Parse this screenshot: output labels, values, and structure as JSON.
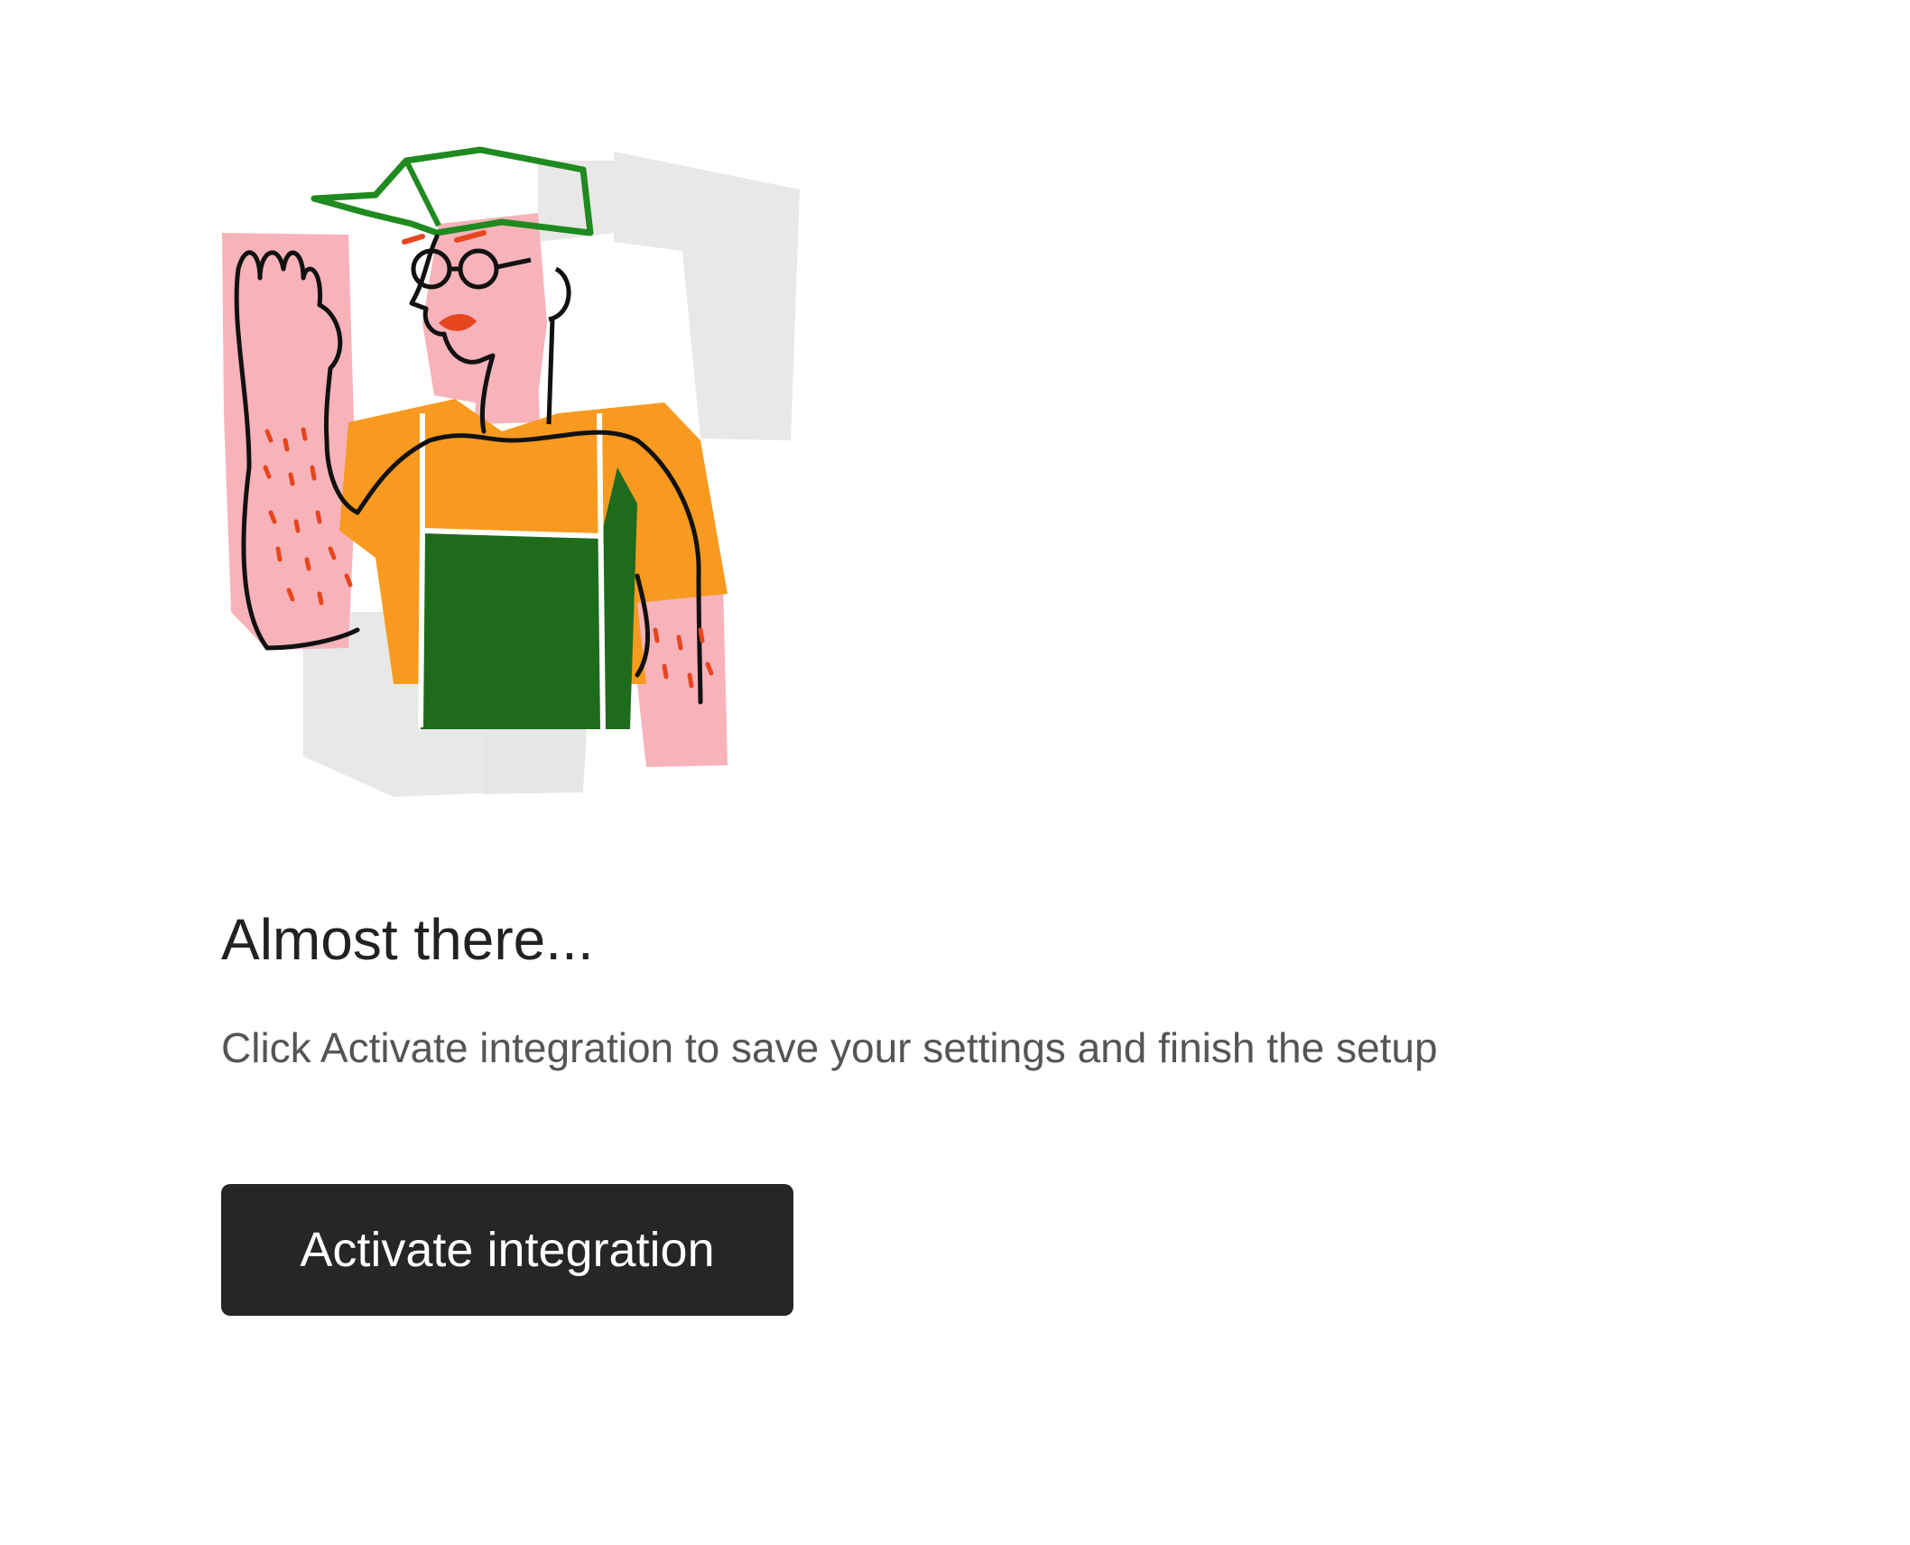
{
  "setup": {
    "title": "Almost there...",
    "description": "Click Activate integration to save your settings and finish the setup",
    "activate_label": "Activate integration"
  },
  "colors": {
    "button_bg": "#262626",
    "button_text": "#ffffff",
    "title_text": "#222222",
    "description_text": "#555555",
    "illustration_pink": "#f7b3b9",
    "illustration_orange": "#f79a1f",
    "illustration_green": "#1f6b1c",
    "illustration_grey": "#e8e8e8"
  },
  "icons": {
    "illustration": "waving-worker-illustration"
  }
}
